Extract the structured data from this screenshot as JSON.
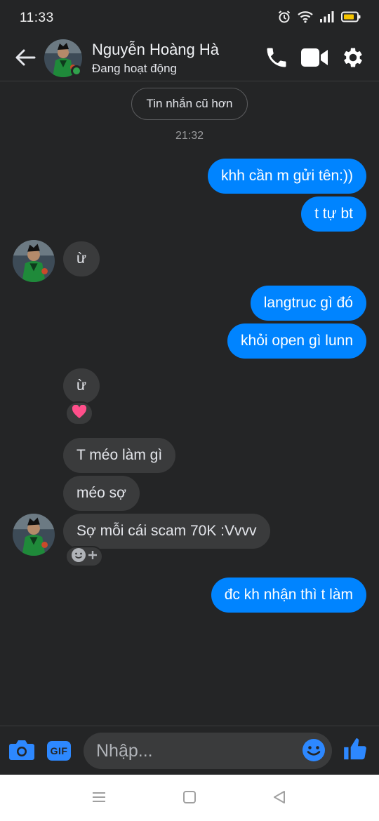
{
  "status_bar": {
    "time": "11:33",
    "icons": [
      "alarm-icon",
      "wifi-icon",
      "signal-icon",
      "battery-icon"
    ]
  },
  "header": {
    "back_icon": "arrow-left-icon",
    "contact_name": "Nguyễn Hoàng Hà",
    "contact_status": "Đang hoạt động",
    "actions": [
      "phone-icon",
      "video-icon",
      "gear-icon"
    ]
  },
  "conversation": {
    "older_messages_label": "Tin nhắn cũ hơn",
    "timestamp": "21:32",
    "messages": [
      {
        "sender": "me",
        "text": "khh cần m gửi tên:))"
      },
      {
        "sender": "me",
        "text": "t tự bt"
      },
      {
        "sender": "them",
        "text": "ừ"
      },
      {
        "sender": "me",
        "text": "langtruc gì đó"
      },
      {
        "sender": "me",
        "text": "khỏi open gì lunn"
      },
      {
        "sender": "them",
        "text": "ừ",
        "reaction": "heart"
      },
      {
        "sender": "them",
        "text": "T méo làm gì"
      },
      {
        "sender": "them",
        "text": "méo sợ"
      },
      {
        "sender": "them",
        "text": "Sợ mỗi cái scam 70K :Vvvv"
      },
      {
        "sender": "me",
        "text": "đc kh nhận thì t làm"
      }
    ]
  },
  "composer": {
    "placeholder": "Nhập...",
    "gif_label": "GIF",
    "icons": [
      "camera-icon",
      "gif-icon",
      "emoji-icon",
      "thumbs-up-icon"
    ]
  },
  "nav_bar": {
    "buttons": [
      "menu-icon",
      "home-icon",
      "back-triangle-icon"
    ]
  },
  "colors": {
    "background": "#242526",
    "outgoing_bubble": "#0084ff",
    "incoming_bubble": "#3a3b3c",
    "accent": "#2d88ff",
    "online": "#31a24c",
    "reaction_heart": "#ff4f8b"
  }
}
